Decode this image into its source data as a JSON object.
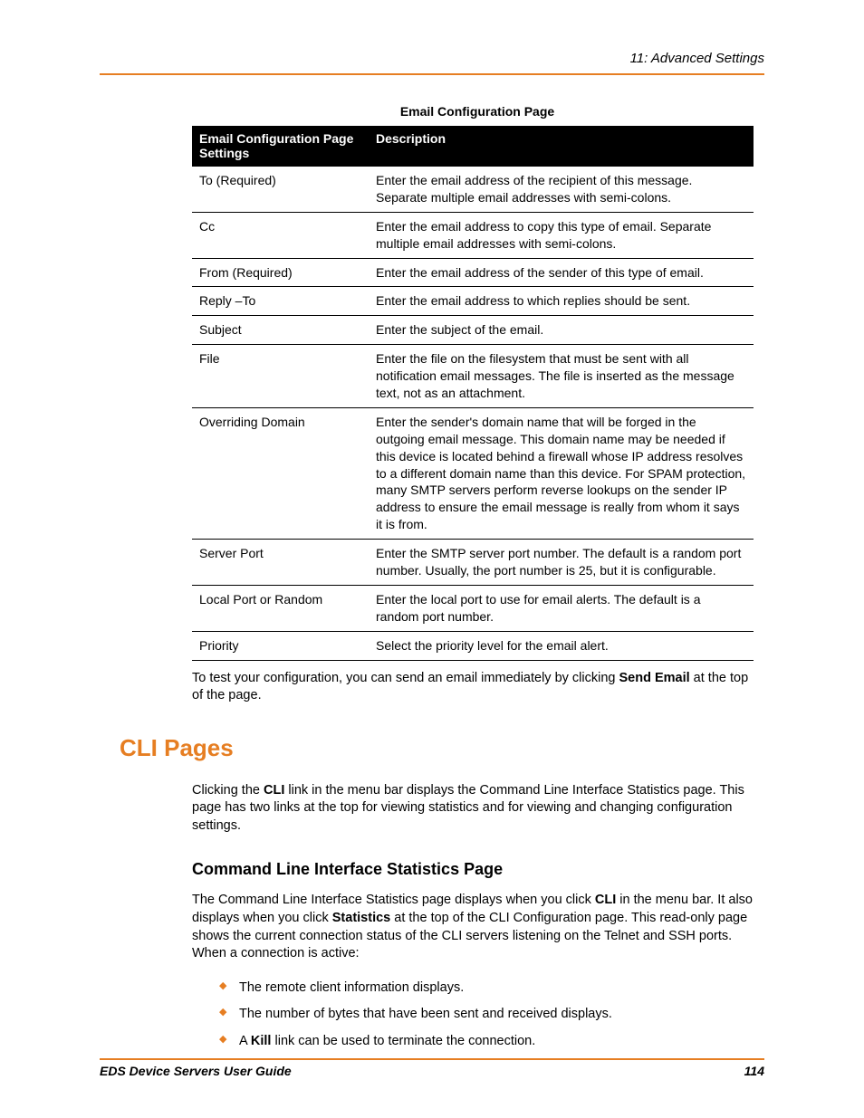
{
  "header": {
    "chapter": "11: Advanced Settings"
  },
  "table": {
    "caption": "Email Configuration Page",
    "col1": "Email Configuration Page Settings",
    "col2": "Description",
    "rows": [
      {
        "setting": "To (Required)",
        "desc": "Enter the email address of the recipient of this message. Separate multiple email addresses with semi-colons."
      },
      {
        "setting": "Cc",
        "desc": "Enter the email address to copy this type of email. Separate multiple email addresses with semi-colons."
      },
      {
        "setting": "From (Required)",
        "desc": "Enter the email address of the sender of this type of email."
      },
      {
        "setting": "Reply –To",
        "desc": "Enter the email address to which replies should be sent."
      },
      {
        "setting": "Subject",
        "desc": "Enter the subject of the email."
      },
      {
        "setting": "File",
        "desc": "Enter the file on the filesystem that must be sent with all notification email messages. The file is inserted as the message text, not as an attachment."
      },
      {
        "setting": "Overriding Domain",
        "desc": "Enter the sender's domain name that will be forged in the outgoing email message. This domain name may be needed if this device is located behind a firewall whose IP address resolves to a different domain name than this device. For SPAM protection, many SMTP servers perform reverse lookups on the sender IP address to ensure the email message is really from whom it says it is from."
      },
      {
        "setting": "Server Port",
        "desc": "Enter the SMTP server port number. The default is a random port number. Usually, the port number is 25, but it is configurable."
      },
      {
        "setting": "Local Port or Random",
        "desc": "Enter the local port to use for email alerts. The default is a random port number."
      },
      {
        "setting": "Priority",
        "desc": "Select the priority level for the email alert."
      }
    ]
  },
  "afterTable": {
    "pre": "To test your configuration, you can send an email immediately by clicking ",
    "bold": "Send Email",
    "post": " at the top of the page."
  },
  "section": {
    "heading": "CLI Pages",
    "para_pre": "Clicking the ",
    "para_bold": "CLI",
    "para_post": " link in the menu bar displays the Command Line Interface Statistics page. This page has two links at the top for viewing statistics and for viewing and changing configuration settings."
  },
  "subsection": {
    "heading": "Command Line Interface Statistics Page",
    "p_pre": "The Command Line Interface Statistics page displays when you click ",
    "p_b1": "CLI",
    "p_mid": " in the menu bar. It also displays when you click ",
    "p_b2": "Statistics",
    "p_post": " at the top of the CLI Configuration page. This read-only page shows the current connection status of the CLI servers listening on the Telnet and SSH ports. When a connection is active:",
    "bullets": {
      "b0": "The remote client information displays.",
      "b1": "The number of bytes that have been sent and received displays.",
      "b2_pre": "A ",
      "b2_bold": "Kill",
      "b2_post": " link can be used to terminate the connection."
    }
  },
  "footer": {
    "left": "EDS Device Servers User Guide",
    "right": "114"
  }
}
